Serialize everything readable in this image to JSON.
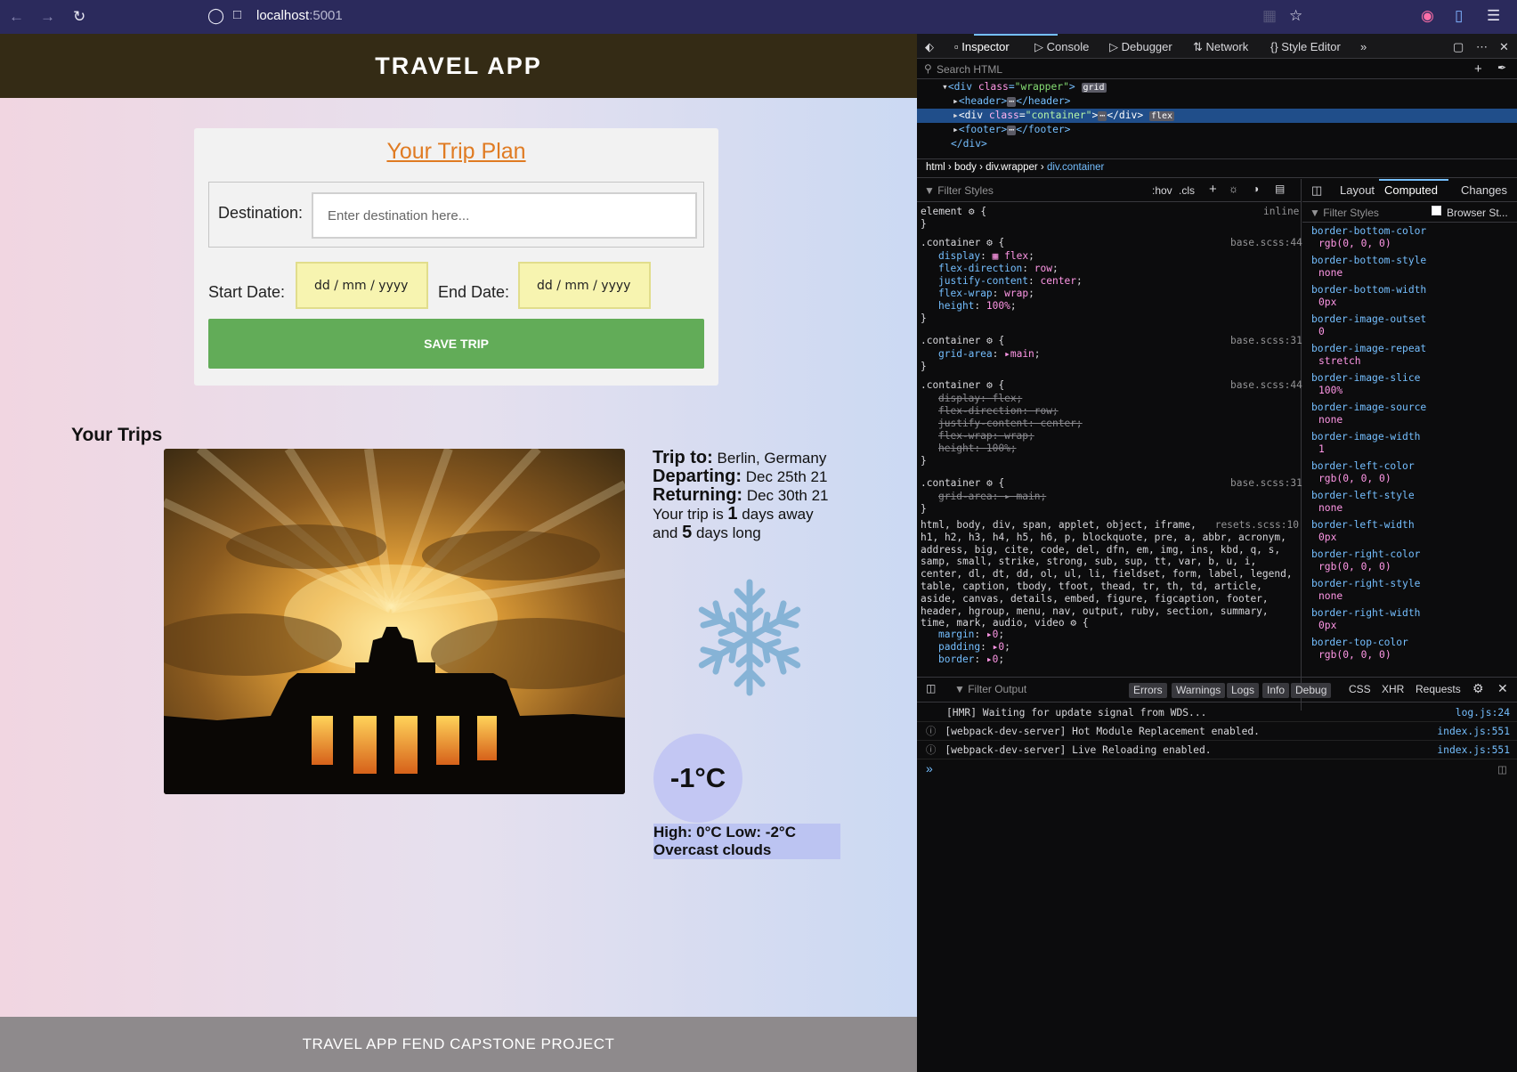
{
  "browser": {
    "url_host": "localhost",
    "url_port": ":5001"
  },
  "app": {
    "title": "TRAVEL APP",
    "form_title": "Your Trip Plan",
    "destination_label": "Destination:",
    "destination_placeholder": "Enter destination here...",
    "start_label": "Start Date:",
    "start_value": "dd / mm / yyyy",
    "end_label": "End Date:",
    "end_value": "dd / mm / yyyy",
    "save_label": "SAVE TRIP",
    "trips_heading": "Your Trips",
    "trip": {
      "to_label": "Trip to:",
      "to_value": "Berlin, Germany",
      "departing_label": "Departing:",
      "departing_value": "Dec 25th 21",
      "returning_label": "Returning:",
      "returning_value": "Dec 30th 21",
      "away_prefix": "Your trip is",
      "away_days": "1",
      "away_suffix": "days away",
      "long_prefix": "and",
      "long_days": "5",
      "long_suffix": "days long",
      "temp": "-1°C",
      "high_low": "High: 0°C Low: -2°C",
      "description": "Overcast clouds",
      "weather_icon": "snowflake-icon"
    },
    "footer": "TRAVEL APP FEND CAPSTONE PROJECT"
  },
  "devtools": {
    "tabs": [
      "Inspector",
      "Console",
      "Debugger",
      "Network",
      "Style Editor"
    ],
    "search_placeholder": "Search HTML",
    "breadcrumbs": [
      "html",
      "body",
      "div.wrapper",
      "div.container"
    ],
    "filter_styles": "Filter Styles",
    "hov": ":hov",
    "cls": ".cls",
    "side_tabs": [
      "Layout",
      "Computed",
      "Changes"
    ],
    "browser_styles": "Browser St...",
    "computed": [
      {
        "name": "border-bottom-color",
        "value": "rgb(0, 0, 0)"
      },
      {
        "name": "border-bottom-style",
        "value": "none"
      },
      {
        "name": "border-bottom-width",
        "value": "0px"
      },
      {
        "name": "border-image-outset",
        "value": "0"
      },
      {
        "name": "border-image-repeat",
        "value": "stretch"
      },
      {
        "name": "border-image-slice",
        "value": "100%"
      },
      {
        "name": "border-image-source",
        "value": "none"
      },
      {
        "name": "border-image-width",
        "value": "1"
      },
      {
        "name": "border-left-color",
        "value": "rgb(0, 0, 0)"
      },
      {
        "name": "border-left-style",
        "value": "none"
      },
      {
        "name": "border-left-width",
        "value": "0px"
      },
      {
        "name": "border-right-color",
        "value": "rgb(0, 0, 0)"
      },
      {
        "name": "border-right-style",
        "value": "none"
      },
      {
        "name": "border-right-width",
        "value": "0px"
      },
      {
        "name": "border-top-color",
        "value": "rgb(0, 0, 0)"
      }
    ],
    "console_filter": "Filter Output",
    "console_levels": [
      "Errors",
      "Warnings",
      "Logs",
      "Info",
      "Debug"
    ],
    "console_types": [
      "CSS",
      "XHR",
      "Requests"
    ],
    "logs": [
      {
        "text": "[HMR] Waiting for update signal from WDS...",
        "src": "log.js:24"
      },
      {
        "text": "[webpack-dev-server] Hot Module Replacement enabled.",
        "src": "index.js:551"
      },
      {
        "text": "[webpack-dev-server] Live Reloading enabled.",
        "src": "index.js:551"
      }
    ]
  }
}
